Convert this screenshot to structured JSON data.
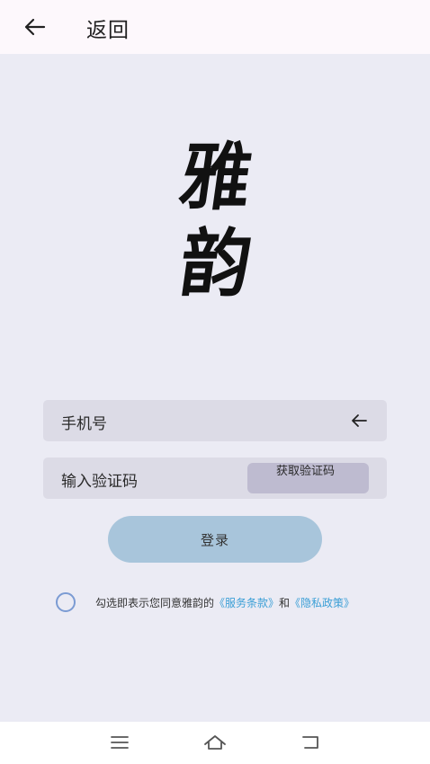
{
  "header": {
    "back_label": "返回",
    "icon": "arrow-left-icon"
  },
  "logo": {
    "line1": "雅",
    "line2": "韵"
  },
  "form": {
    "phone_label": "手机号",
    "phone_icon": "arrow-left-icon",
    "code_label": "输入验证码",
    "get_code_label": "获取验证码",
    "login_label": "登录"
  },
  "agreement": {
    "prefix": "勾选即表示您同意雅韵的",
    "terms_link": "《服务条款》",
    "conjunction": "和",
    "privacy_link": "《隐私政策》",
    "checked": false
  },
  "navbar": {
    "icons": [
      "menu-icon",
      "home-icon",
      "back-icon"
    ]
  },
  "colors": {
    "background": "#ebebf4",
    "field": "#dcdbe6",
    "login_button": "#a8c5db",
    "link": "#3b9fd6"
  }
}
